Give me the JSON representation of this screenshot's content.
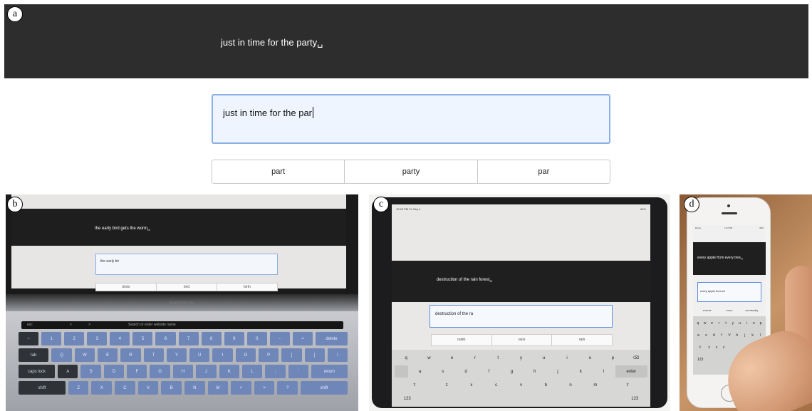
{
  "labels": {
    "a": "a",
    "b": "b",
    "c": "c",
    "d": "d"
  },
  "panel_a": {
    "target_phrase": "just in time for the party␣",
    "input_text": "just in time for the par",
    "suggestions": [
      "part",
      "party",
      "par"
    ]
  },
  "panel_b": {
    "target_phrase": "the early bird gets the worm␣",
    "input_text": "the early bir",
    "suggestions": [
      "birds",
      "bird",
      "birth"
    ],
    "brand": "MacBook Pro",
    "touchbar": [
      "esc",
      "<",
      ">",
      "Search or enter website name"
    ],
    "key_rows": [
      [
        "~",
        "1",
        "2",
        "3",
        "4",
        "5",
        "6",
        "7",
        "8",
        "9",
        "0",
        "-",
        "=",
        "delete"
      ],
      [
        "tab",
        "Q",
        "W",
        "E",
        "R",
        "T",
        "Y",
        "U",
        "I",
        "O",
        "P",
        "[",
        "]",
        "\\"
      ],
      [
        "caps lock",
        "A",
        "S",
        "D",
        "F",
        "G",
        "H",
        "J",
        "K",
        "L",
        ";",
        "'",
        "return"
      ],
      [
        "shift",
        "Z",
        "X",
        "C",
        "V",
        "B",
        "N",
        "M",
        "<",
        ">",
        "?",
        "shift"
      ]
    ]
  },
  "panel_c": {
    "status_left": "12:26 PM  Fri Sep 4",
    "status_right": "94%",
    "target_phrase": "destruction of the rain forest␣",
    "input_text": "destruction of the ra",
    "suggestions": [
      "radio",
      "race",
      "rain"
    ],
    "key_rows": [
      [
        "q",
        "w",
        "e",
        "r",
        "t",
        "y",
        "u",
        "i",
        "o",
        "p",
        "⌫"
      ],
      [
        "a",
        "s",
        "d",
        "f",
        "g",
        "h",
        "j",
        "k",
        "l",
        "enter"
      ],
      [
        "⇧",
        "z",
        "x",
        "c",
        "v",
        "b",
        "n",
        "m",
        "⇧"
      ],
      [
        "123",
        "",
        "123"
      ]
    ]
  },
  "panel_d": {
    "status_left": "Roots",
    "status_center": "1:23 PM",
    "status_right": "49%",
    "target_phrase": "every apple from every tree␣",
    "input_text": "every apple from ev",
    "suggestions": [
      "events",
      "even",
      "eventually"
    ],
    "key_rows": [
      [
        "q",
        "w",
        "e",
        "r",
        "t",
        "y",
        "u",
        "i",
        "o",
        "p"
      ],
      [
        "a",
        "s",
        "d",
        "f",
        "V",
        "h",
        "j",
        "k",
        "l"
      ],
      [
        "⇧",
        "z",
        "x",
        "c"
      ],
      [
        "123"
      ]
    ]
  }
}
